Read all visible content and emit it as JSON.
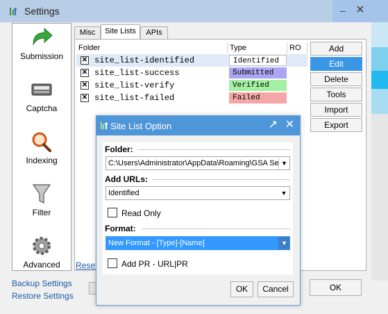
{
  "window": {
    "title": "Settings",
    "minimize": "–",
    "close": "✕"
  },
  "sidebar": {
    "items": [
      {
        "label": "Submission",
        "icon": "arrow-icon"
      },
      {
        "label": "Captcha",
        "icon": "keyboard-icon"
      },
      {
        "label": "Indexing",
        "icon": "magnifier-icon"
      },
      {
        "label": "Filter",
        "icon": "funnel-icon"
      },
      {
        "label": "Advanced",
        "icon": "gear-icon"
      }
    ]
  },
  "tabs": [
    "Misc",
    "Site Lists",
    "APIs"
  ],
  "table": {
    "headers": [
      "Folder",
      "Type",
      "RO"
    ],
    "rows": [
      {
        "name": "site_list-identified",
        "type": "Identified",
        "type_color": "#ffffff"
      },
      {
        "name": "site_list-success",
        "type": "Submitted",
        "type_color": "#aaa6f2"
      },
      {
        "name": "site_list-verify",
        "type": "Verified",
        "type_color": "#a3f0a3"
      },
      {
        "name": "site_list-failed",
        "type": "Failed",
        "type_color": "#f5a6a6"
      }
    ]
  },
  "buttons": {
    "add": "Add",
    "edit": "Edit",
    "delete": "Delete",
    "tools": "Tools",
    "import": "Import",
    "export": "Export"
  },
  "links": {
    "reset": "Reset",
    "backup": "Backup Settings",
    "restore": "Restore Settings"
  },
  "main_ok": "OK",
  "dialog": {
    "title": "Site List Option",
    "expand": "↗",
    "close": "✕",
    "folder_label": "Folder:",
    "folder_value": "C:\\Users\\Administrator\\AppData\\Roaming\\GSA Sea",
    "add_urls_label": "Add URLs:",
    "add_urls_value": "Identified",
    "read_only_label": "Read Only",
    "format_label": "Format:",
    "format_value": "New Format - [Type]-[Name]",
    "add_pr_label": "Add PR - URL|PR",
    "ok": "OK",
    "cancel": "Cancel"
  },
  "colors": {
    "accent": "#3c96e6",
    "dialog_title": "#4f96d8"
  }
}
